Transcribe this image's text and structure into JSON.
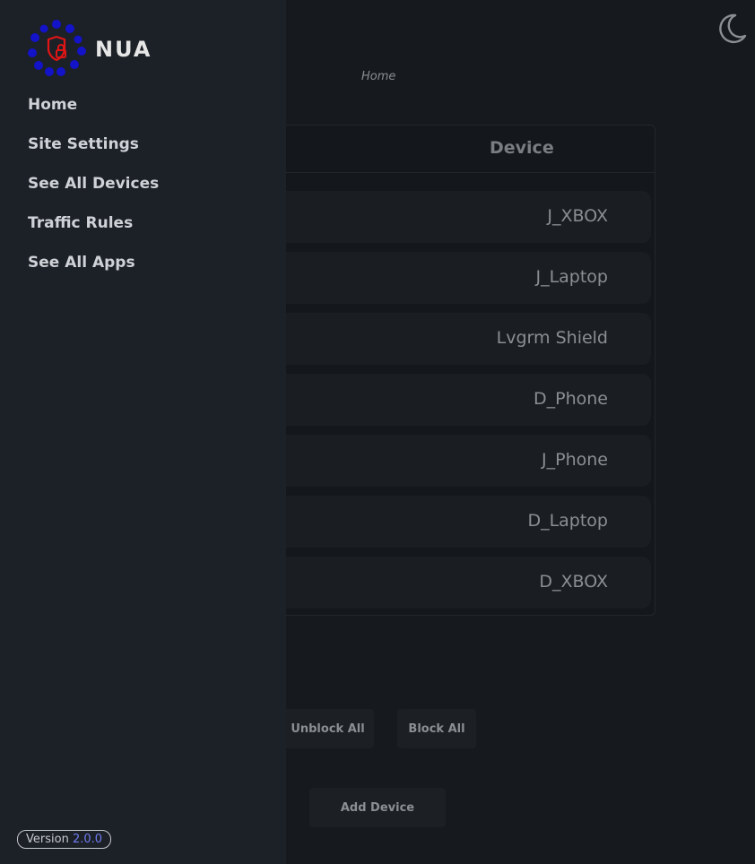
{
  "app": {
    "logo_text": "NUA",
    "version_label": "Version",
    "version_number": "2.0.0"
  },
  "colors": {
    "drawer_bg": "#1c2027",
    "page_bg": "#16191e",
    "logo_dots": "#1313c8",
    "logo_lock": "#e01515",
    "version_accent": "#6f7cf0"
  },
  "header": {
    "theme_toggle_icon": "moon-icon",
    "breadcrumb": "Home"
  },
  "nav": {
    "items": [
      {
        "label": "Home"
      },
      {
        "label": "Site Settings"
      },
      {
        "label": "See All Devices"
      },
      {
        "label": "Traffic Rules"
      },
      {
        "label": "See All Apps"
      }
    ]
  },
  "devices": {
    "column_header": "Device",
    "rows": [
      {
        "name": "J_XBOX"
      },
      {
        "name": "J_Laptop"
      },
      {
        "name": "Lvgrm Shield"
      },
      {
        "name": "D_Phone"
      },
      {
        "name": "J_Phone"
      },
      {
        "name": "D_Laptop"
      },
      {
        "name": "D_XBOX"
      }
    ]
  },
  "actions": {
    "unblock_all": "Unblock All",
    "block_all": "Block All",
    "add_device": "Add Device"
  }
}
